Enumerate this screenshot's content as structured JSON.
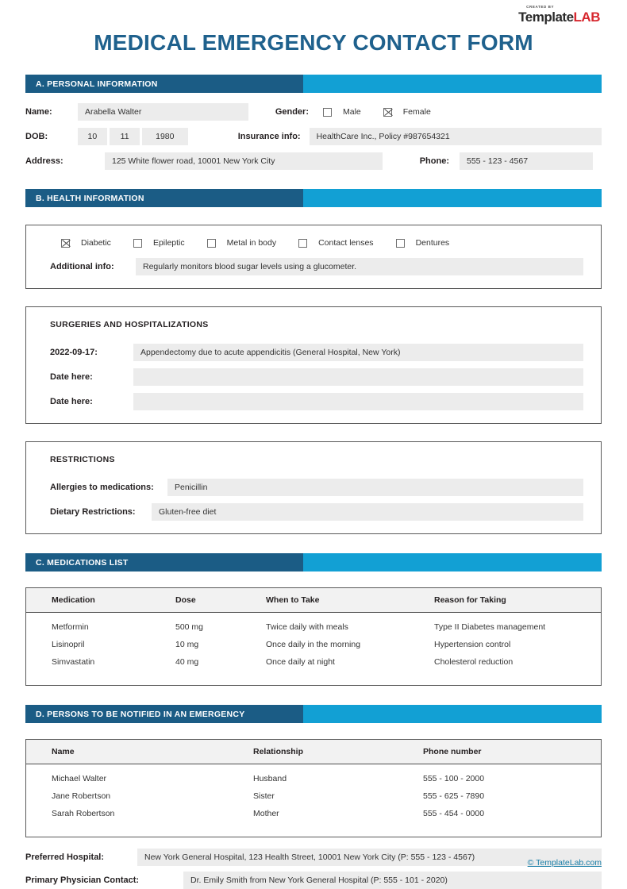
{
  "logo": {
    "created_by": "CREATED BY",
    "name_dark": "Template",
    "name_red": "LAB"
  },
  "title": "MEDICAL EMERGENCY CONTACT FORM",
  "colors": {
    "title": "#1f618d",
    "bar_dark": "#1b5c85",
    "bar_light": "#12a0d4",
    "field_bg": "#ececec",
    "logo_red": "#d7282f",
    "footer_link": "#1b7fa8"
  },
  "sections": {
    "a": {
      "title": "A. PERSONAL INFORMATION"
    },
    "b": {
      "title": "B. HEALTH INFORMATION"
    },
    "c": {
      "title": "C. MEDICATIONS LIST"
    },
    "d": {
      "title": "D. PERSONS TO BE NOTIFIED IN AN EMERGENCY"
    }
  },
  "personal": {
    "name_label": "Name:",
    "name_value": "Arabella Walter",
    "gender_label": "Gender:",
    "gender_options": [
      {
        "label": "Male",
        "checked": false
      },
      {
        "label": "Female",
        "checked": true
      }
    ],
    "dob_label": "DOB:",
    "dob_day": "10",
    "dob_month": "11",
    "dob_year": "1980",
    "insurance_label": "Insurance info:",
    "insurance_value": "HealthCare Inc., Policy #987654321",
    "address_label": "Address:",
    "address_value": "125 White flower road, 10001 New York City",
    "phone_label": "Phone:",
    "phone_value": "555 - 123 - 4567"
  },
  "health": {
    "conditions": [
      {
        "label": "Diabetic",
        "checked": true
      },
      {
        "label": "Epileptic",
        "checked": false
      },
      {
        "label": "Metal in body",
        "checked": false
      },
      {
        "label": "Contact lenses",
        "checked": false
      },
      {
        "label": "Dentures",
        "checked": false
      }
    ],
    "additional_info_label": "Additional info:",
    "additional_info_value": "Regularly monitors blood sugar levels using a glucometer."
  },
  "surgeries": {
    "title": "SURGERIES AND HOSPITALIZATIONS",
    "rows": [
      {
        "label": "2022-09-17:",
        "value": "Appendectomy due to acute appendicitis (General Hospital, New York)"
      },
      {
        "label": "Date here:",
        "value": ""
      },
      {
        "label": "Date here:",
        "value": ""
      }
    ]
  },
  "restrictions": {
    "title": "RESTRICTIONS",
    "allergies_label": "Allergies to medications:",
    "allergies_value": "Penicillin",
    "dietary_label": "Dietary Restrictions:",
    "dietary_value": "Gluten-free diet"
  },
  "medications": {
    "headers": [
      "Medication",
      "Dose",
      "When to Take",
      "Reason for Taking"
    ],
    "rows": [
      [
        "Metformin",
        "500 mg",
        "Twice daily with meals",
        "Type II Diabetes management"
      ],
      [
        "Lisinopril",
        "10 mg",
        "Once daily in the morning",
        "Hypertension control"
      ],
      [
        "Simvastatin",
        "40 mg",
        "Once daily at night",
        "Cholesterol reduction"
      ]
    ]
  },
  "emergency_contacts": {
    "headers": [
      "Name",
      "Relationship",
      "Phone number"
    ],
    "rows": [
      [
        "Michael Walter",
        "Husband",
        "555 - 100 - 2000"
      ],
      [
        "Jane Robertson",
        "Sister",
        "555 - 625 - 7890"
      ],
      [
        "Sarah Robertson",
        "Mother",
        "555 - 454 - 0000"
      ]
    ]
  },
  "bottom": {
    "hospital_label": "Preferred Hospital:",
    "hospital_value": "New York General Hospital, 123 Health Street, 10001 New York City  (P: 555 - 123 - 4567)",
    "physician_label": "Primary Physician Contact:",
    "physician_value": "Dr. Emily Smith from New York General Hospital (P: 555 - 101 - 2020)"
  },
  "footer": {
    "link_text": "© TemplateLab.com"
  }
}
